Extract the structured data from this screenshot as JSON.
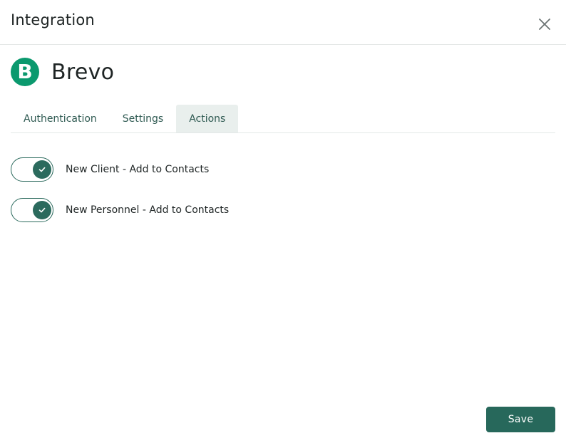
{
  "dialog": {
    "title": "Integration",
    "close_icon": "close-icon"
  },
  "brand": {
    "logo_letter": "B",
    "logo_color": "#0b996e",
    "name": "Brevo"
  },
  "tabs": [
    {
      "label": "Authentication",
      "active": false
    },
    {
      "label": "Settings",
      "active": false
    },
    {
      "label": "Actions",
      "active": true
    }
  ],
  "actions": [
    {
      "label": "New Client - Add to Contacts",
      "enabled": true
    },
    {
      "label": "New Personnel - Add to Contacts",
      "enabled": true
    }
  ],
  "footer": {
    "save_label": "Save"
  },
  "colors": {
    "accent": "#27685b",
    "tab_active_bg": "#e9efed"
  }
}
